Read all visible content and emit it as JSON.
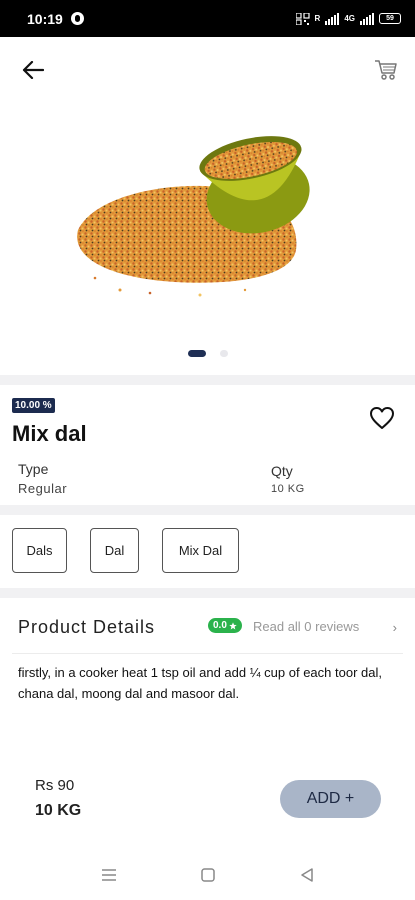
{
  "status_bar": {
    "time": "10:19",
    "battery": "59"
  },
  "icons": {
    "back": "arrow-left-icon",
    "cart": "cart-icon",
    "favorite": "heart-outline-icon",
    "star": "star-icon",
    "chevron": "chevron-right-icon",
    "nav_menu": "menu-lines-icon",
    "nav_home": "square-home-icon",
    "nav_back": "triangle-back-icon"
  },
  "product": {
    "discount": "10.00 %",
    "name": "Mix dal",
    "type_label": "Type",
    "type_value": "Regular",
    "qty_label": "Qty",
    "qty_value": "10 KG",
    "tags": [
      "Dals",
      "Dal",
      "Mix Dal"
    ],
    "image_page": 1,
    "image_count": 2
  },
  "details": {
    "title": "Product Details",
    "rating": "0.0",
    "reviews_link": "Read all 0 reviews",
    "description": "firstly, in a cooker heat 1 tsp oil and add ¼ cup of each toor dal, chana dal, moong dal and masoor dal."
  },
  "purchase": {
    "price": "Rs 90",
    "quantity": "10 KG",
    "add_label": "ADD +"
  },
  "colors": {
    "accent_navy": "#1c2b4f",
    "add_button": "#a9b5c8",
    "rating_green": "#2bb24c"
  }
}
